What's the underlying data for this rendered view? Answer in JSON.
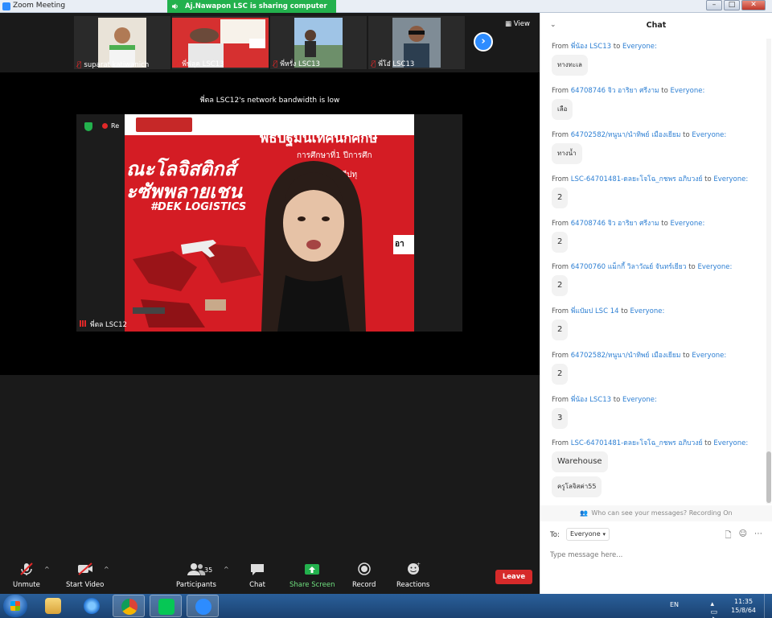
{
  "window": {
    "title": "Zoom Meeting",
    "share_banner": "Aj.Nawapon LSC is sharing computer sound",
    "controls": [
      "–",
      "□",
      "✕"
    ]
  },
  "participants_strip": {
    "thumbs": [
      {
        "name": "suparat katiwanich",
        "muted": true
      },
      {
        "name": "พี่ฟลุค LSC13",
        "muted": true
      },
      {
        "name": "พี่หรั่ง LSC13",
        "muted": true
      },
      {
        "name": "พี่โอ๋ LSC13",
        "muted": true
      }
    ],
    "next_icon": "›",
    "view_label": "View"
  },
  "stage": {
    "bandwidth_note": "พี่ตล LSC12's network bandwidth is low",
    "recording_label": "Re",
    "speaker_name": "พี่ตล LSC12",
    "slide": {
      "headline": "พิธีปฐมนิเทศนักศึกษ",
      "subline1": "การศึกษาที่1 ปีการศึก",
      "subline2": "มหาวิทยาลัยศรีปทุ",
      "big_line1": "ณะโลจิสติกส์",
      "big_line2": "ะซัพพลายเชน",
      "hashtag": "#DEK LOGISTICS",
      "box_text": "อา"
    }
  },
  "toolbar": {
    "unmute": "Unmute",
    "start_video": "Start Video",
    "participants": "Participants",
    "participants_count": "35",
    "chat": "Chat",
    "share_screen": "Share Screen",
    "record": "Record",
    "reactions": "Reactions",
    "leave": "Leave"
  },
  "chat": {
    "title": "Chat",
    "messages": [
      {
        "from": "พี่น้อง LSC13",
        "to": "Everyone:",
        "text": "ทางทะเล"
      },
      {
        "from": "64708746 จิว อาริยา ศรีงาม",
        "to": "Everyone:",
        "text": "เลือ"
      },
      {
        "from": "64702582/หนูนา/นำทิพย์ เมืองเยียม",
        "to": "Everyone:",
        "text": "ทางน้ำ"
      },
      {
        "from": "LSC-64701481-ดลยะโจโฉ_กชพร อภิบวงย์",
        "to": "Everyone:",
        "text": "2"
      },
      {
        "from": "64708746 จิว อาริยา ศรีงาม",
        "to": "Everyone:",
        "text": "2"
      },
      {
        "from": "64700760 แม็กกี้ วิลาวัณย์ จันทร์เยียว",
        "to": "Everyone:",
        "text": "2"
      },
      {
        "from": "พี่แป๋มป LSC 14",
        "to": "Everyone:",
        "text": "2"
      },
      {
        "from": "64702582/หนูนา/นำทิพย์ เมืองเยียม",
        "to": "Everyone:",
        "text": "2"
      },
      {
        "from": "พี่น้อง LSC13",
        "to": "Everyone:",
        "text": "3"
      },
      {
        "from": "LSC-64701481-ดลยะโจโฉ_กชพร อภิบวงย์",
        "to": "Everyone:",
        "text": "Warehouse",
        "text2": "ครูโลจิสค่า55"
      }
    ],
    "from_prefix": "From",
    "to_word": "to",
    "privacy_note": "Who can see your messages? Recording On",
    "to_label": "To:",
    "to_value": "Everyone",
    "placeholder": "Type message here..."
  },
  "taskbar": {
    "lang": "EN",
    "time": "11:35",
    "date": "15/8/64",
    "apps": [
      "explorer",
      "internet-explorer",
      "chrome",
      "line",
      "zoom"
    ]
  },
  "colors": {
    "zoom_blue": "#2d8cff",
    "share_green": "#23b14d",
    "leave_red": "#d62a2a",
    "chat_name_blue": "#2d7fd3"
  }
}
